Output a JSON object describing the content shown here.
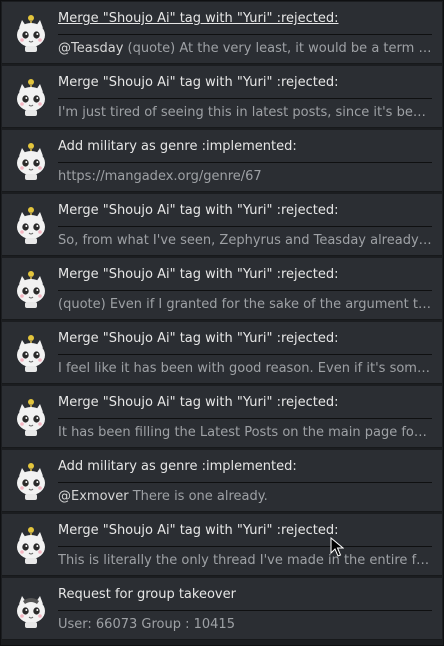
{
  "notifications": [
    {
      "title": "Merge \"Shoujo Ai\" tag with \"Yuri\" :rejected:",
      "mention": "@Teasday",
      "preview": " (quote) At the very least, it would be a term that ...",
      "underline": true
    },
    {
      "title": "Merge \"Shoujo Ai\" tag with \"Yuri\" :rejected:",
      "mention": "",
      "preview": "I'm just tired of seeing this in latest posts, since it's been ...",
      "underline": false
    },
    {
      "title": "Add military as genre :implemented:",
      "mention": "",
      "preview": "https://mangadex.org/genre/67",
      "underline": false
    },
    {
      "title": "Merge \"Shoujo Ai\" tag with \"Yuri\" :rejected:",
      "mention": "",
      "preview": "So, from what I've seen, Zephyrus and Teasday already g...",
      "underline": false
    },
    {
      "title": "Merge \"Shoujo Ai\" tag with \"Yuri\" :rejected:",
      "mention": "",
      "preview": "(quote) Even if I granted for the sake of the argument th...",
      "underline": false
    },
    {
      "title": "Merge \"Shoujo Ai\" tag with \"Yuri\" :rejected:",
      "mention": "",
      "preview": "I feel like it has been with good reason. Even if it's somet...",
      "underline": false
    },
    {
      "title": "Merge \"Shoujo Ai\" tag with \"Yuri\" :rejected:",
      "mention": "",
      "preview": "It has been filling the Latest Posts on the main page for ...",
      "underline": false
    },
    {
      "title": "Add military as genre :implemented:",
      "mention": "@Exmover",
      "preview": " There is one already.",
      "underline": false
    },
    {
      "title": "Merge \"Shoujo Ai\" tag with \"Yuri\" :rejected:",
      "mention": "",
      "preview": "This is literally the only thread I've made in the entire for...",
      "underline": false
    },
    {
      "title": "Request for group takeover",
      "mention": "",
      "preview": "User: 66073 Group : 10415",
      "underline": false
    }
  ],
  "avatar_icon": "cat-mascot-icon",
  "colors": {
    "item_bg": "#2b2e33",
    "title": "#e6e6e6",
    "preview": "#9ea1a5",
    "page_bg": "#1b1d20"
  }
}
